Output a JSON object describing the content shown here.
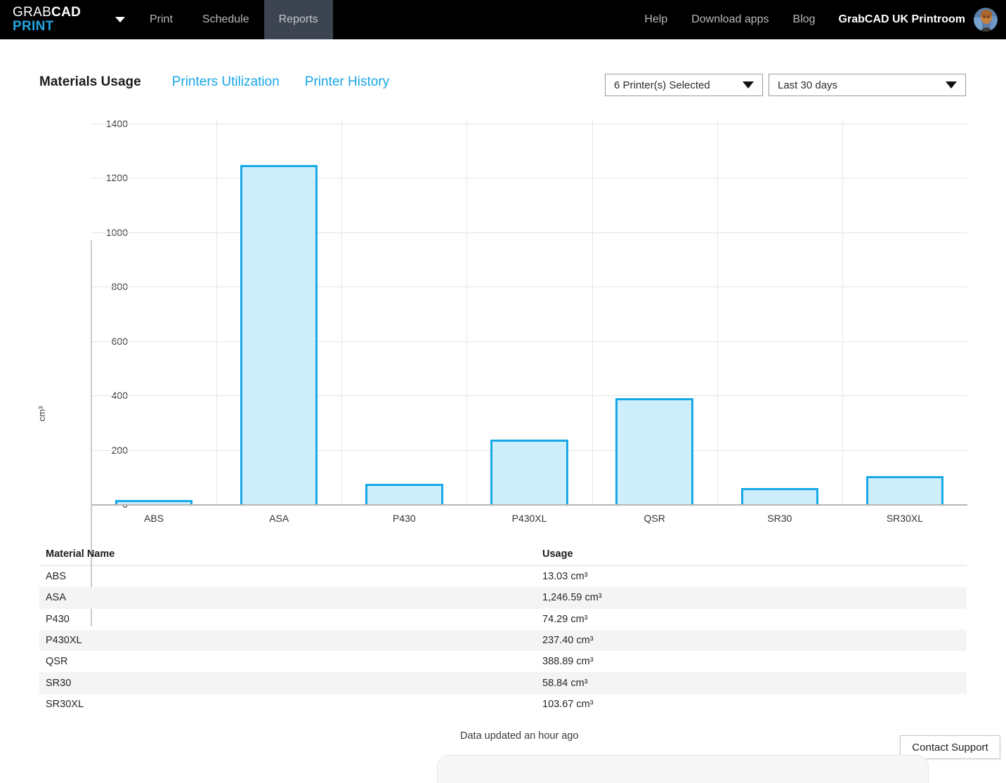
{
  "topbar": {
    "logo_line1_light": "GRAB",
    "logo_line1_bold": "CAD",
    "logo_line2": "PRINT",
    "app_menu_icon": "chevron-down-icon",
    "nav": [
      {
        "label": "Print",
        "active": false
      },
      {
        "label": "Schedule",
        "active": false
      },
      {
        "label": "Reports",
        "active": true
      }
    ],
    "right_links": [
      {
        "label": "Help"
      },
      {
        "label": "Download apps"
      },
      {
        "label": "Blog"
      }
    ],
    "account_name": "GrabCAD UK Printroom",
    "avatar_icon": "user-avatar"
  },
  "toolbar": {
    "tabs": [
      {
        "label": "Materials Usage",
        "current": true
      },
      {
        "label": "Printers Utilization",
        "current": false
      },
      {
        "label": "Printer History",
        "current": false
      }
    ],
    "printer_filter": {
      "value": "6 Printer(s) Selected",
      "caret_icon": "chevron-down-icon"
    },
    "date_filter": {
      "value": "Last 30 days",
      "caret_icon": "chevron-down-icon"
    }
  },
  "chart_data": {
    "type": "bar",
    "title": "",
    "xlabel": "",
    "ylabel": "cm³",
    "categories": [
      "ABS",
      "ASA",
      "P430",
      "P430XL",
      "QSR",
      "SR30",
      "SR30XL"
    ],
    "values": [
      13.03,
      1246.59,
      74.29,
      237.4,
      388.89,
      58.84,
      103.67
    ],
    "ylim": [
      0,
      1400
    ],
    "yticks": [
      0,
      200,
      400,
      600,
      800,
      1000,
      1200,
      1400
    ],
    "ytick_labels": [
      "0",
      "200",
      "400",
      "600",
      "800",
      "1000",
      "1200",
      "1400"
    ],
    "grid": true,
    "legend": "none",
    "bar_fill_color": "#cdeefa",
    "bar_border_color": "#18a8e8"
  },
  "table": {
    "columns": [
      "Material Name",
      "Usage"
    ],
    "rows": [
      {
        "name": "ABS",
        "usage": "13.03 cm³"
      },
      {
        "name": "ASA",
        "usage": "1,246.59 cm³"
      },
      {
        "name": "P430",
        "usage": "74.29 cm³"
      },
      {
        "name": "P430XL",
        "usage": "237.40 cm³"
      },
      {
        "name": "QSR",
        "usage": "388.89 cm³"
      },
      {
        "name": "SR30",
        "usage": "58.84 cm³"
      },
      {
        "name": "SR30XL",
        "usage": "103.67 cm³"
      }
    ]
  },
  "footer": {
    "updated_note": "Data updated an hour ago",
    "contact_support_label": "Contact Support"
  },
  "colors": {
    "brand_blue": "#22a5e0",
    "link_blue": "#18a5e6",
    "topbar_bg": "#000000",
    "active_tab_bg": "#3b4450",
    "bar_fill": "#cdeefa",
    "bar_border": "#18a8e8",
    "row_alt_bg": "#f4f4f4"
  }
}
